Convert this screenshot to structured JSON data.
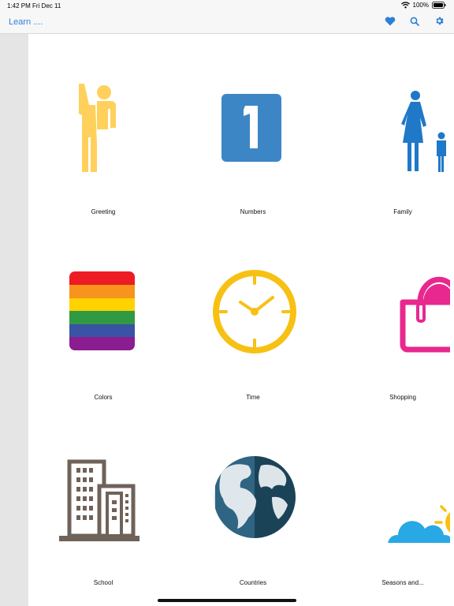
{
  "status_bar": {
    "time": "1:42 PM",
    "date": "Fri Dec 11",
    "battery": "100%"
  },
  "nav": {
    "title": "Learn ....",
    "favorites_icon": "heart-icon",
    "search_icon": "search-icon",
    "settings_icon": "gear-icon",
    "accent_color": "#2f7fd6"
  },
  "categories": [
    {
      "label": "Greeting",
      "icon": "waving-person-icon"
    },
    {
      "label": "Numbers",
      "icon": "number-one-icon"
    },
    {
      "label": "Family",
      "icon": "family-icon"
    },
    {
      "label": "Colors",
      "icon": "rainbow-stripes-icon"
    },
    {
      "label": "Time",
      "icon": "clock-icon"
    },
    {
      "label": "Shopping",
      "icon": "shopping-bag-icon"
    },
    {
      "label": "School",
      "icon": "building-icon"
    },
    {
      "label": "Countries",
      "icon": "globe-icon"
    },
    {
      "label": "Seasons and...",
      "icon": "cloud-sun-icon"
    }
  ]
}
